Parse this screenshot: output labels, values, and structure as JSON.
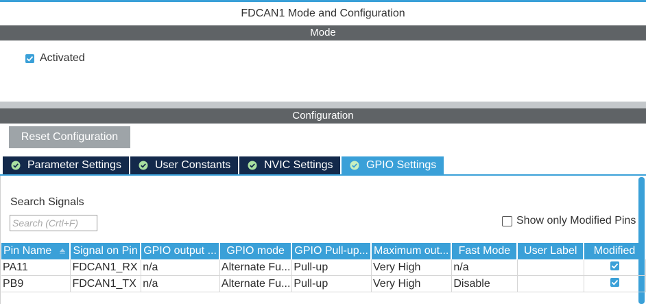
{
  "window": {
    "title": "FDCAN1 Mode and Configuration"
  },
  "mode": {
    "header": "Mode",
    "activated": {
      "label": "Activated",
      "checked": true
    }
  },
  "configuration": {
    "header": "Configuration",
    "reset_button": "Reset Configuration",
    "tabs": [
      {
        "label": "Parameter Settings",
        "icon": "check-circle-icon",
        "active": false
      },
      {
        "label": "User Constants",
        "icon": "check-circle-icon",
        "active": false
      },
      {
        "label": "NVIC Settings",
        "icon": "check-circle-icon",
        "active": false
      },
      {
        "label": "GPIO Settings",
        "icon": "check-circle-icon",
        "active": true
      }
    ]
  },
  "gpio": {
    "search_label": "Search Signals",
    "search_placeholder": "Search (Crtl+F)",
    "search_value": "",
    "show_modified": {
      "label": "Show only Modified Pins",
      "checked": false
    },
    "columns": [
      "Pin Name",
      "Signal on Pin",
      "GPIO output ...",
      "GPIO mode",
      "GPIO Pull-up...",
      "Maximum out...",
      "Fast Mode",
      "User Label",
      "Modified"
    ],
    "rows": [
      {
        "pin": "PA11",
        "signal": "FDCAN1_RX",
        "output": "n/a",
        "mode": "Alternate Fu...",
        "pull": "Pull-up",
        "speed": "Very High",
        "fast": "n/a",
        "label": "",
        "modified": true
      },
      {
        "pin": "PB9",
        "signal": "FDCAN1_TX",
        "output": "n/a",
        "mode": "Alternate Fu...",
        "pull": "Pull-up",
        "speed": "Very High",
        "fast": "Disable",
        "label": "",
        "modified": true
      }
    ]
  },
  "colors": {
    "accent": "#3aa0d8",
    "tab_dark": "#13294b",
    "section_bar": "#5f6366",
    "button_gray": "#9ea4a8"
  }
}
